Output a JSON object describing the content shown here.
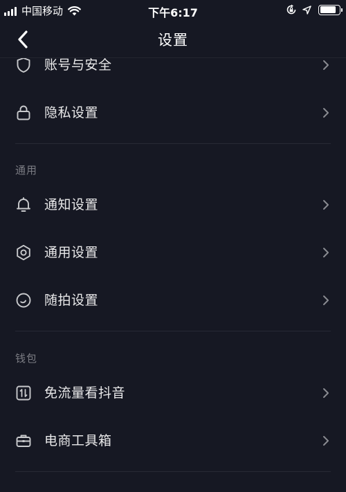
{
  "status_bar": {
    "carrier": "中国移动",
    "time": "下午6:17",
    "battery_level": 0.85
  },
  "nav": {
    "title": "设置"
  },
  "sections": {
    "account": {
      "items": [
        {
          "label": "账号与安全",
          "icon": "shield-icon"
        },
        {
          "label": "隐私设置",
          "icon": "lock-icon"
        }
      ]
    },
    "general": {
      "header": "通用",
      "items": [
        {
          "label": "通知设置",
          "icon": "bell-icon"
        },
        {
          "label": "通用设置",
          "icon": "gear-icon"
        },
        {
          "label": "随拍设置",
          "icon": "snap-icon"
        }
      ]
    },
    "wallet": {
      "header": "钱包",
      "items": [
        {
          "label": "免流量看抖音",
          "icon": "data-free-icon"
        },
        {
          "label": "电商工具箱",
          "icon": "briefcase-icon"
        }
      ]
    }
  },
  "colors": {
    "background": "#161823",
    "text": "#e9e9ea",
    "section_header": "#7b7c83",
    "icon": "#c9cacd",
    "chevron": "#8a8b91",
    "divider": "#272935"
  }
}
